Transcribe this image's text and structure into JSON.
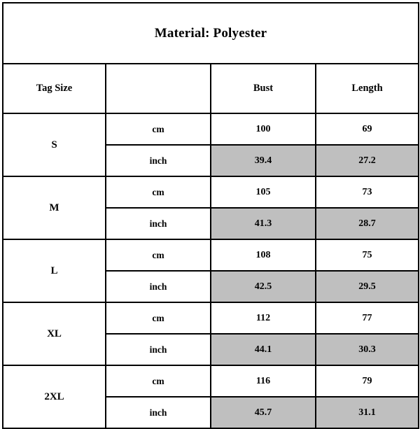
{
  "table": {
    "title": "Material: Polyester",
    "headers": {
      "tag_size": "Tag Size",
      "unit": "",
      "bust": "Bust",
      "length": "Length"
    },
    "unit_labels": {
      "cm": "cm",
      "inch": "inch"
    },
    "shade_color": "#bfbfbf",
    "border_color": "#000000",
    "rows": [
      {
        "size": "S",
        "cm": {
          "bust": "100",
          "length": "69"
        },
        "inch": {
          "bust": "39.4",
          "length": "27.2"
        }
      },
      {
        "size": "M",
        "cm": {
          "bust": "105",
          "length": "73"
        },
        "inch": {
          "bust": "41.3",
          "length": "28.7"
        }
      },
      {
        "size": "L",
        "cm": {
          "bust": "108",
          "length": "75"
        },
        "inch": {
          "bust": "42.5",
          "length": "29.5"
        }
      },
      {
        "size": "XL",
        "cm": {
          "bust": "112",
          "length": "77"
        },
        "inch": {
          "bust": "44.1",
          "length": "30.3"
        }
      },
      {
        "size": "2XL",
        "cm": {
          "bust": "116",
          "length": "79"
        },
        "inch": {
          "bust": "45.7",
          "length": "31.1"
        }
      }
    ]
  }
}
